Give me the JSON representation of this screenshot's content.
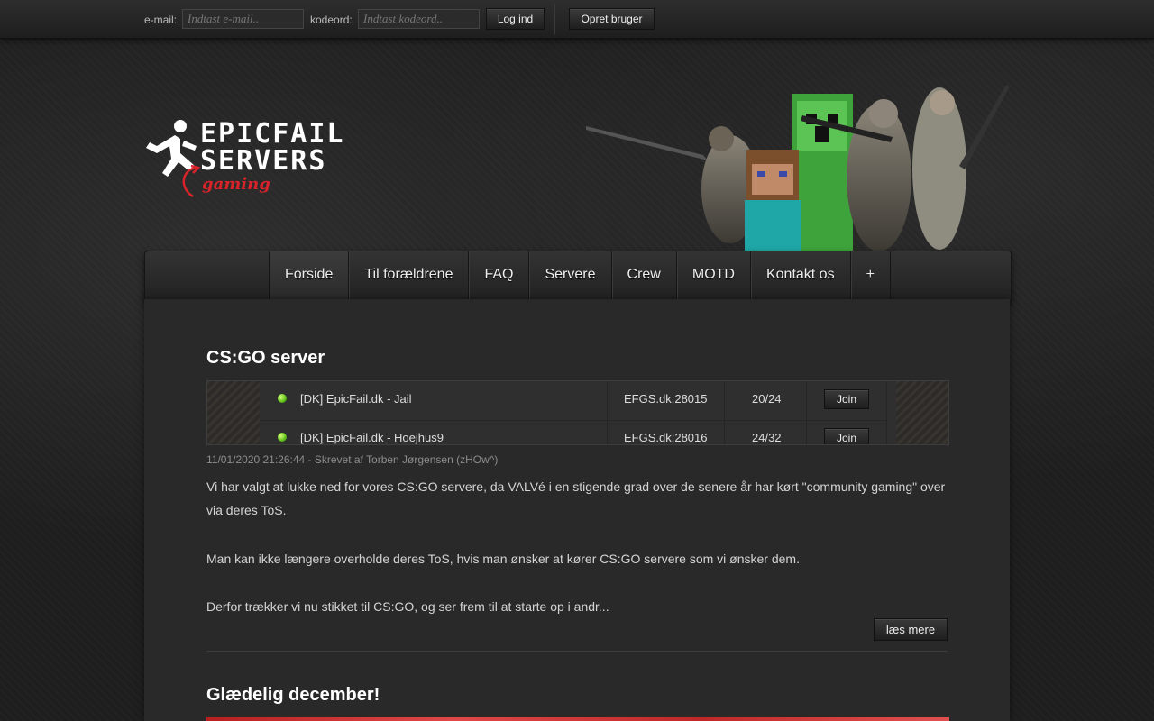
{
  "login": {
    "email_label": "e-mail:",
    "email_placeholder": "Indtast e-mail..",
    "password_label": "kodeord:",
    "password_placeholder": "Indtast kodeord..",
    "login_button": "Log ind",
    "register_button": "Opret bruger"
  },
  "logo": {
    "line1": "EPICFAIL",
    "line2": "SERVERS",
    "tagline": "gaming"
  },
  "nav": {
    "items": [
      {
        "label": "Forside",
        "active": true
      },
      {
        "label": "Til forældrene"
      },
      {
        "label": "FAQ"
      },
      {
        "label": "Servere"
      },
      {
        "label": "Crew"
      },
      {
        "label": "MOTD"
      },
      {
        "label": "Kontakt os"
      },
      {
        "label": "+"
      }
    ]
  },
  "posts": [
    {
      "title": "CS:GO server",
      "servers": [
        {
          "name": "[DK] EpicFail.dk - Jail",
          "address": "EFGS.dk:28015",
          "players": "20/24",
          "action": "Join",
          "status_color": "#6fd01f"
        },
        {
          "name": "[DK] EpicFail.dk - Hoejhus9",
          "address": "EFGS.dk:28016",
          "players": "24/32",
          "action": "Join",
          "status_color": "#6fd01f"
        }
      ],
      "meta": "11/01/2020 21:26:44 - Skrevet af Torben Jørgensen (zHOw^)",
      "paragraphs": [
        "Vi har valgt at lukke ned for vores CS:GO servere, da VALVé i en stigende grad over de senere år har kørt \"community gaming\" over via deres ToS.",
        "Man kan ikke længere overholde deres ToS, hvis man ønsker at kører CS:GO servere som vi ønsker dem.",
        "Derfor trækker vi nu stikket til CS:GO, og ser frem til at starte op i andr..."
      ],
      "read_more": "læs mere"
    },
    {
      "title": "Glædelig december!"
    }
  ],
  "colors": {
    "accent_red": "#d8232a",
    "status_online": "#6fd01f"
  }
}
